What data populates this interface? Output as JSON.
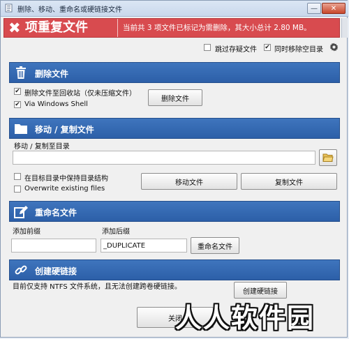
{
  "window": {
    "title": "删除、移动、重命名或硬链接文件",
    "min_glyph": "—",
    "close_glyph": "✕"
  },
  "banner": {
    "x_glyph": "✖",
    "title": "项重复文件",
    "message": "当前共 3 项文件已标记为需删除，其大小总计 2.80 MB。",
    "color": "#d84b4f"
  },
  "options": {
    "skip_suspect": {
      "label": "跳过存疑文件",
      "checked": false
    },
    "remove_empty_dirs": {
      "label": "同时移除空目录",
      "checked": true
    },
    "gear_icon": "gear-icon"
  },
  "delete_section": {
    "title": "删除文件",
    "icon": "trash-icon",
    "recycle": {
      "label": "删除文件至回收站（仅未压缩文件）",
      "checked": true
    },
    "shell": {
      "label": "Via Windows Shell",
      "checked": true
    },
    "button": "删除文件"
  },
  "move_section": {
    "title": "移动 / 复制文件",
    "icon": "folder-icon",
    "target_label": "移动 / 复制至目录",
    "target_value": "",
    "keep_structure": {
      "label": "在目标目录中保持目录结构",
      "checked": false
    },
    "overwrite": {
      "label": "Overwrite existing files",
      "checked": false
    },
    "move_button": "移动文件",
    "copy_button": "复制文件"
  },
  "rename_section": {
    "title": "重命名文件",
    "icon": "edit-icon",
    "prefix_label": "添加前缀",
    "prefix_value": "",
    "suffix_label": "添加后缀",
    "suffix_value": "_DUPLICATE",
    "button": "重命名文件"
  },
  "hardlink_section": {
    "title": "创建硬链接",
    "icon": "link-icon",
    "note": "目前仅支持 NTFS 文件系统，且无法创建跨卷硬链接。",
    "button": "创建硬链接"
  },
  "footer": {
    "close_button": "关闭"
  },
  "watermark": "人人软件园",
  "colors": {
    "section_header": "#2c5fa8",
    "banner": "#d84b4f"
  }
}
